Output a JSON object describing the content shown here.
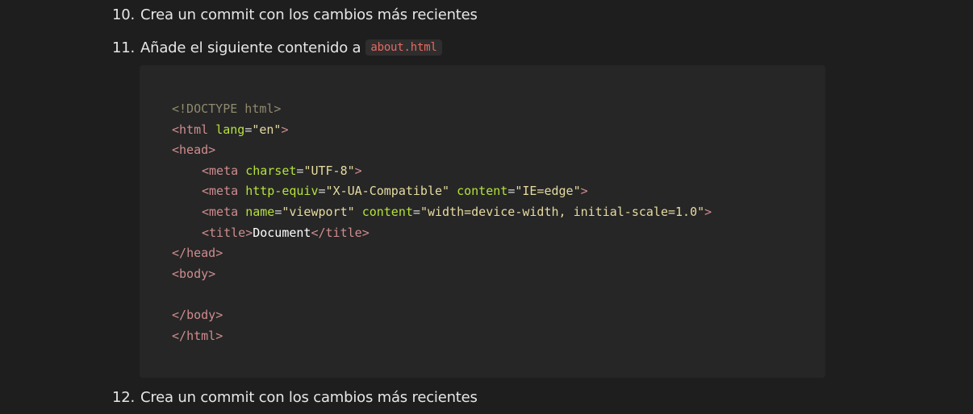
{
  "steps": [
    {
      "number": "10.",
      "text": "Crea un commit con los cambios más recientes"
    },
    {
      "number": "11.",
      "text": "Añade el siguiente contenido a",
      "code": "about.html"
    },
    {
      "number": "12.",
      "text": "Crea un commit con los cambios más recientes"
    }
  ],
  "code_block": {
    "language": "html",
    "lines": {
      "doctype": "<!DOCTYPE html>",
      "html_open": {
        "tag": "html",
        "attr": "lang",
        "value": "\"en\""
      },
      "head_open": "head",
      "meta_charset": {
        "tag": "meta",
        "attr": "charset",
        "value": "\"UTF-8\""
      },
      "meta_compat": {
        "tag": "meta",
        "attr1": "http-equiv",
        "value1": "\"X-UA-Compatible\"",
        "attr2": "content",
        "value2": "\"IE=edge\""
      },
      "meta_viewport": {
        "tag": "meta",
        "attr1": "name",
        "value1": "\"viewport\"",
        "attr2": "content",
        "value2": "\"width=device-width, initial-scale=1.0\""
      },
      "title": {
        "tag": "title",
        "text": "Document"
      },
      "head_close": "head",
      "body_open": "body",
      "body_close": "body",
      "html_close": "html"
    }
  },
  "colors": {
    "background": "#1e1e1e",
    "code_background": "#262626",
    "inline_code_text": "#e8685f",
    "tag": "#cf8c8f",
    "attribute": "#b6e23b",
    "string": "#e6dba0",
    "doctype": "#8f8a6e"
  }
}
